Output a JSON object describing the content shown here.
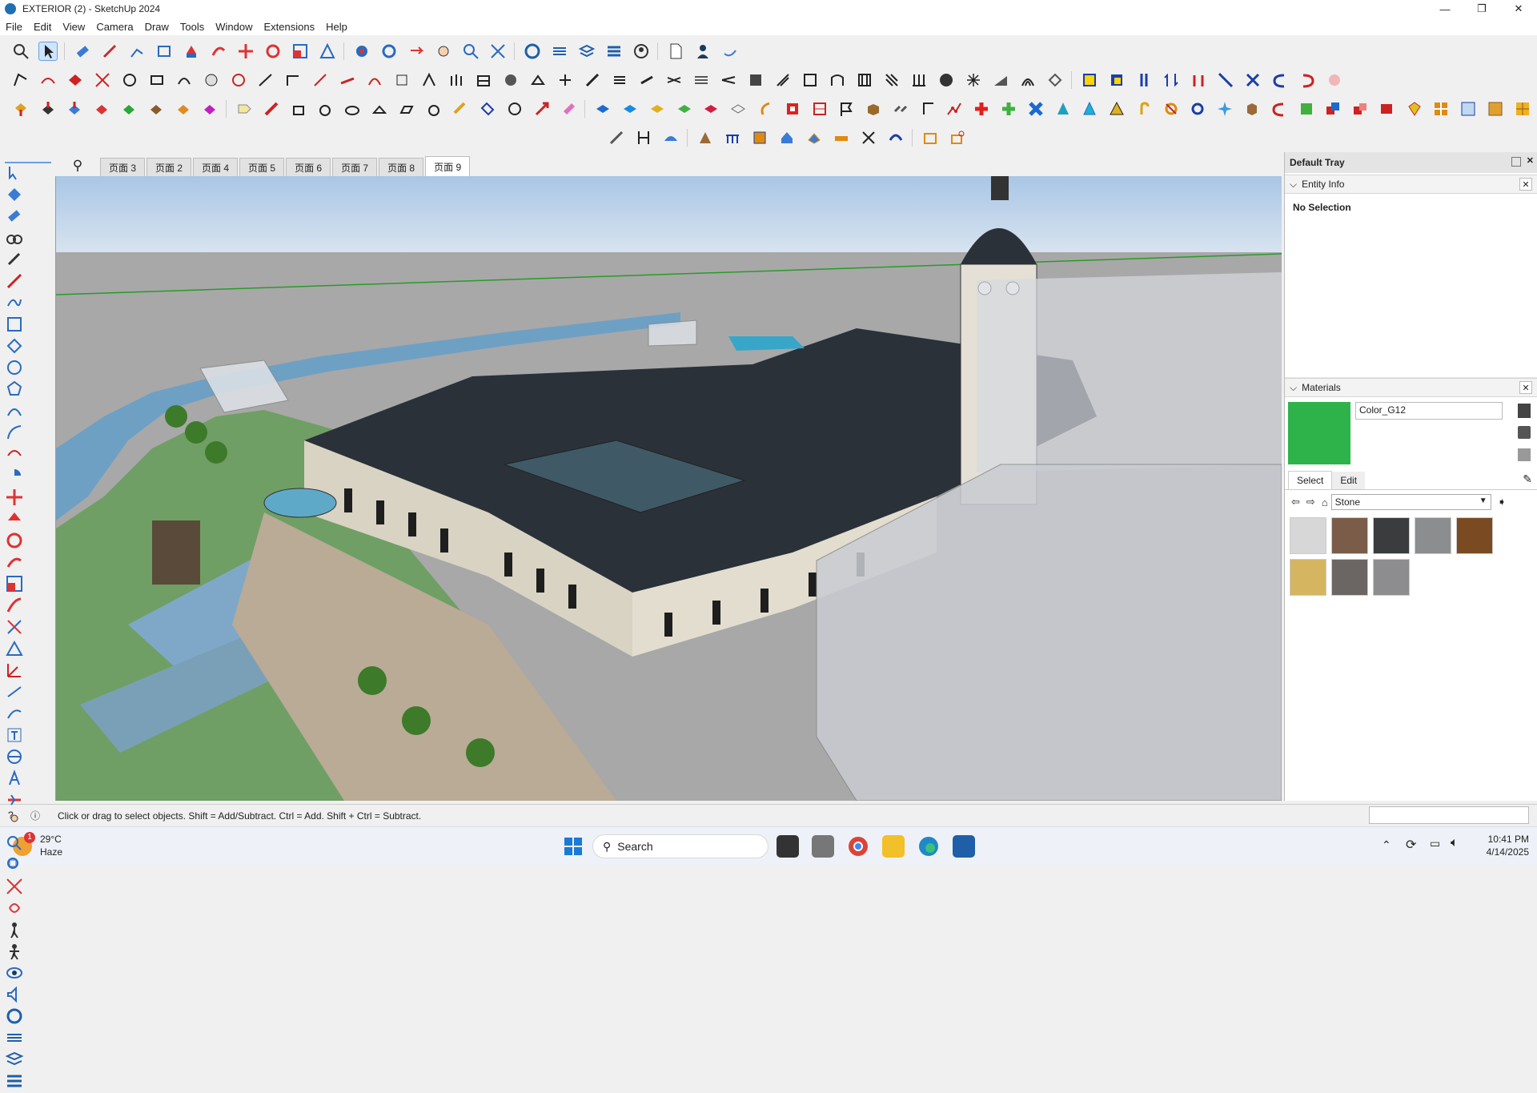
{
  "window": {
    "title": "EXTERIOR  (2) - SketchUp 2024",
    "minimize": "—",
    "maximize": "❐",
    "close": "✕"
  },
  "menu": [
    "File",
    "Edit",
    "View",
    "Camera",
    "Draw",
    "Tools",
    "Window",
    "Extensions",
    "Help"
  ],
  "scene_tabs": [
    "页面 3",
    "页面 2",
    "页面 4",
    "页面 5",
    "页面 6",
    "页面 7",
    "页面 8",
    "页面 9"
  ],
  "active_tab": "页面 9",
  "tray": {
    "title": "Default Tray",
    "entity_info": {
      "header": "Entity Info",
      "value": "No Selection"
    },
    "materials": {
      "header": "Materials",
      "current_name": "Color_G12",
      "current_color": "#2db34a",
      "tab_select": "Select",
      "tab_edit": "Edit",
      "library": "Stone",
      "swatches": [
        "#d7d7d7",
        "#7a5c48",
        "#3a3c3e",
        "#8b8d8e",
        "#7a4a22",
        "#d6b560",
        "#6b6563",
        "#8d8d90"
      ]
    }
  },
  "status": {
    "message": "Click or drag to select objects. Shift = Add/Subtract. Ctrl = Add. Shift + Ctrl = Subtract."
  },
  "taskbar": {
    "weather_temp": "29°C",
    "weather_desc": "Haze",
    "weather_badge": "1",
    "search_placeholder": "Search",
    "time": "10:41 PM",
    "date": "4/14/2025"
  }
}
